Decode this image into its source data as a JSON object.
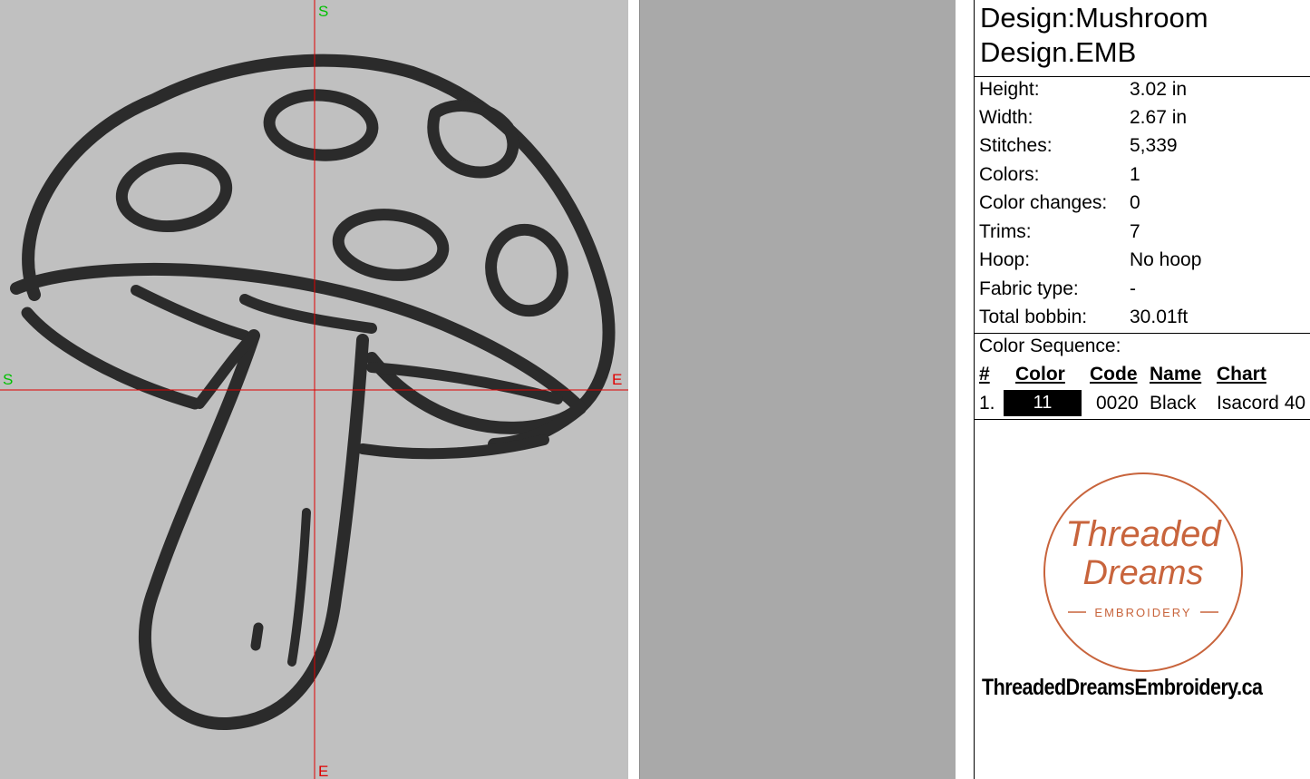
{
  "canvas": {
    "axis_labels": {
      "top": "S",
      "bottom": "E",
      "left": "S",
      "right": "E"
    },
    "colors": {
      "background": "#c0c0c0",
      "axis": "#e00000",
      "start_marker": "#00c000",
      "thread": "#2b2b2b"
    }
  },
  "design": {
    "title_line1": "Design:Mushroom",
    "title_line2": "Design.EMB"
  },
  "properties": [
    {
      "label": "Height:",
      "value": "3.02 in"
    },
    {
      "label": "Width:",
      "value": "2.67 in"
    },
    {
      "label": "Stitches:",
      "value": "5,339"
    },
    {
      "label": "Colors:",
      "value": "1"
    },
    {
      "label": "Color changes:",
      "value": "0"
    },
    {
      "label": "Trims:",
      "value": "7"
    },
    {
      "label": "Hoop:",
      "value": "No hoop"
    },
    {
      "label": "Fabric type:",
      "value": "-"
    },
    {
      "label": "Total bobbin:",
      "value": "30.01ft"
    }
  ],
  "color_sequence": {
    "title": "Color Sequence:",
    "headers": {
      "num": "#",
      "color": "Color",
      "code": "Code",
      "name": "Name",
      "chart": "Chart"
    },
    "rows": [
      {
        "num": "1.",
        "swatch_label": "11",
        "swatch_color": "#000000",
        "code": "0020",
        "name": "Black",
        "chart": "Isacord 40"
      }
    ]
  },
  "logo": {
    "script_line1": "Threaded",
    "script_line2": "Dreams",
    "subtitle": "EMBROIDERY",
    "color": "#c8643c"
  },
  "website": "ThreadedDreamsEmbroidery.ca"
}
